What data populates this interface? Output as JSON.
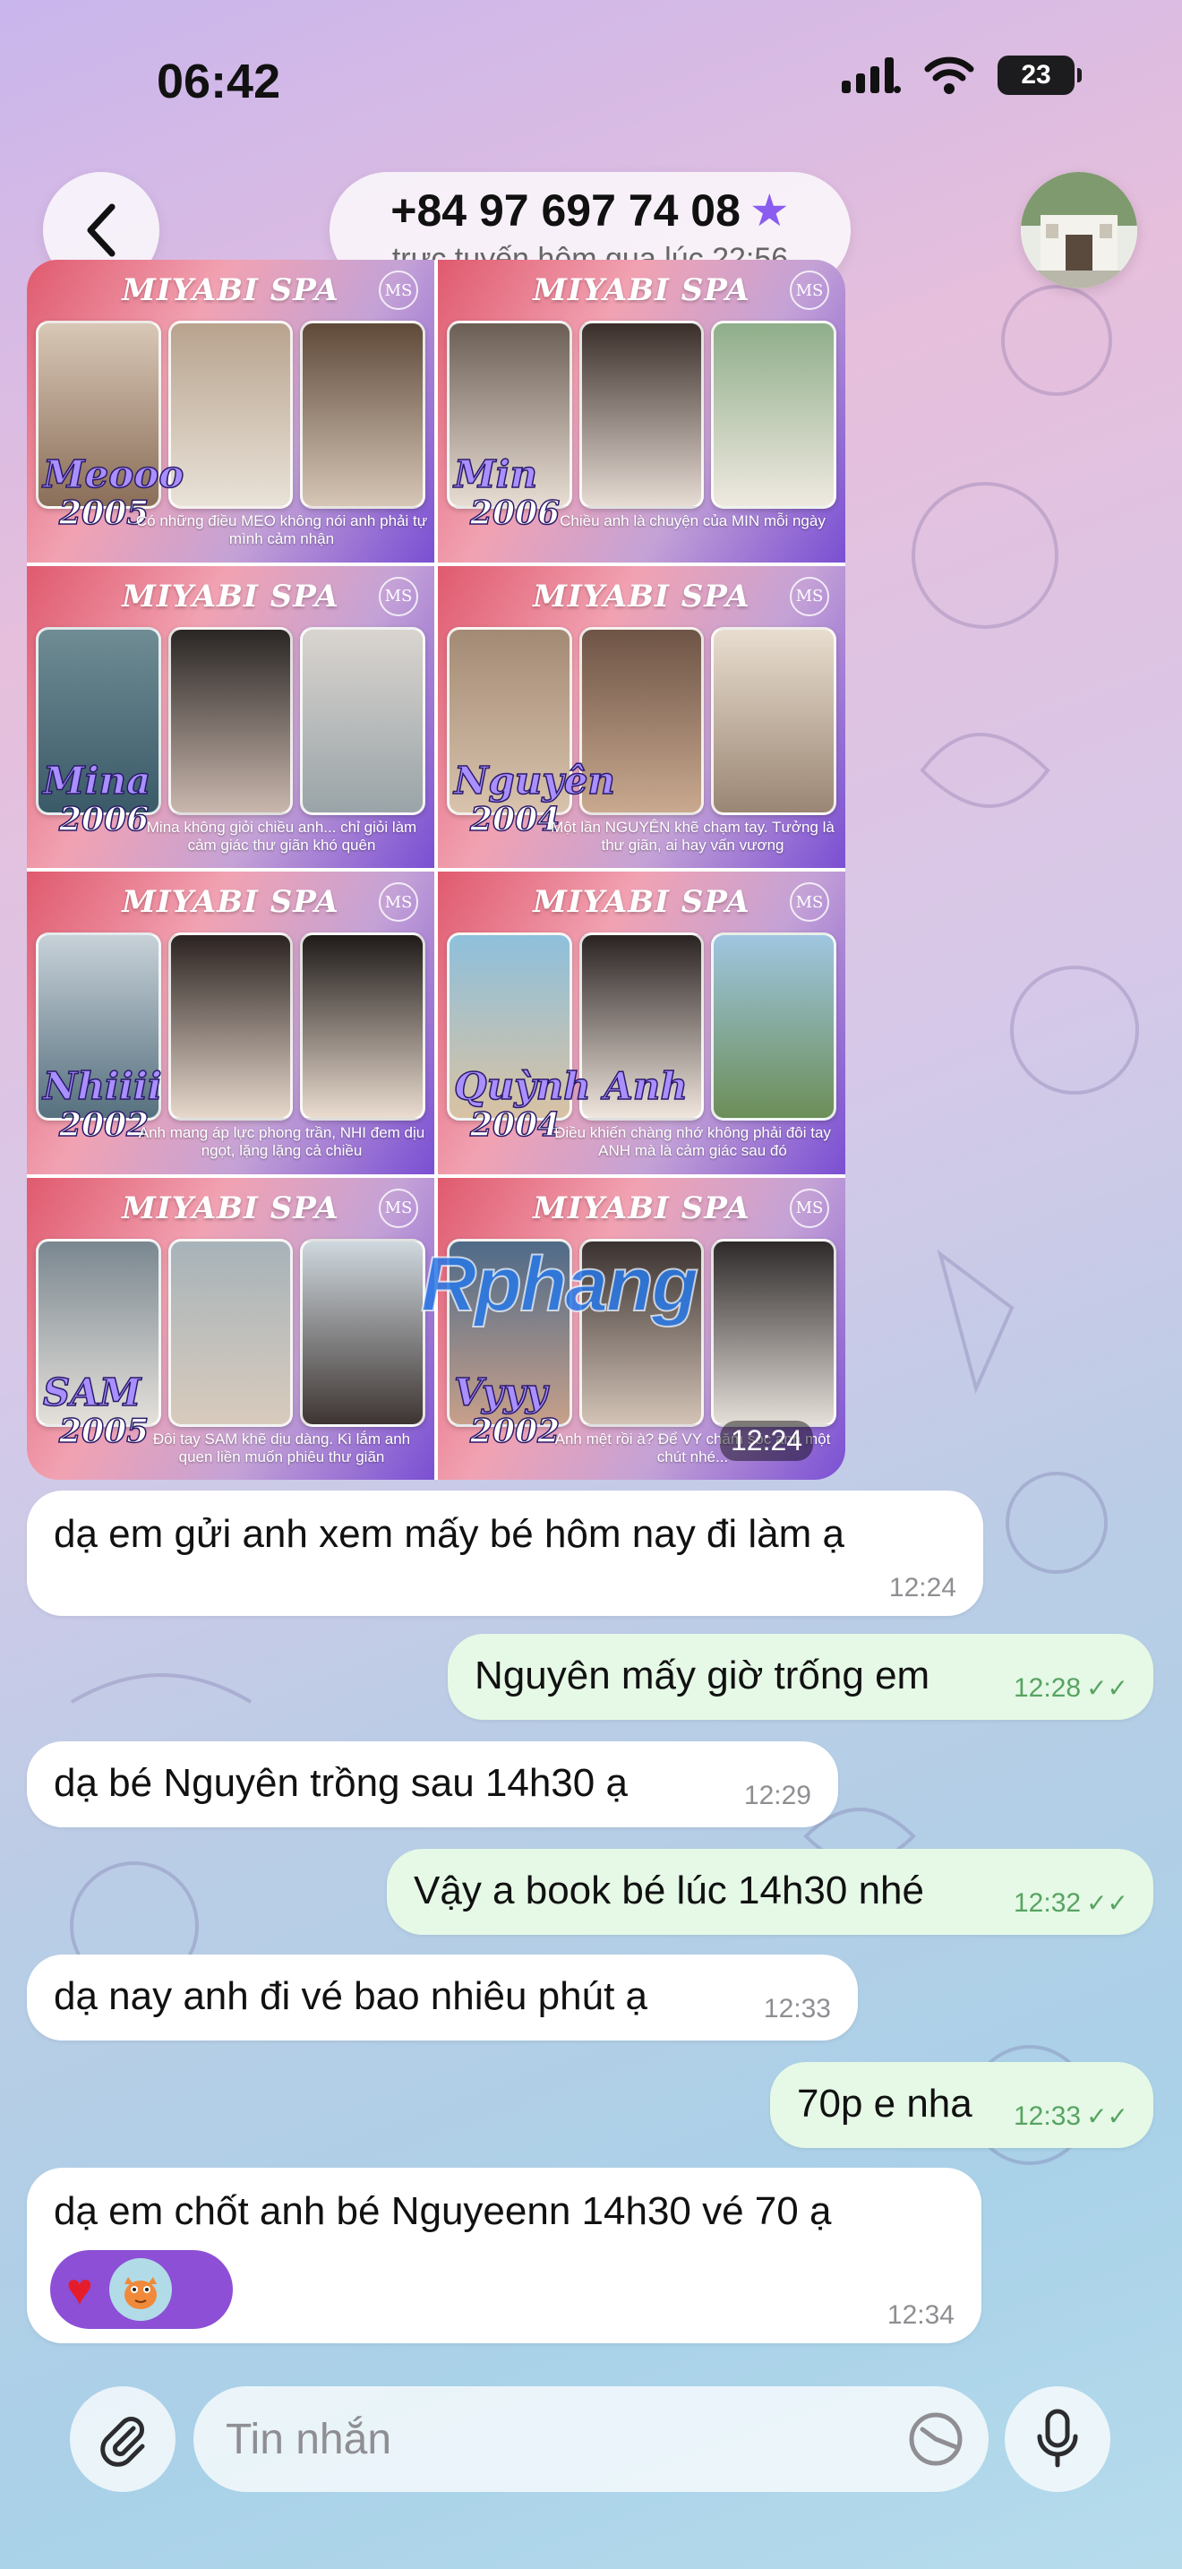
{
  "status_bar": {
    "time": "06:42",
    "battery": "23"
  },
  "header": {
    "contact_name": "+84 97 697 74 08",
    "contact_status": "trực tuyến hôm qua lúc 22:56"
  },
  "gallery": {
    "brand": "MIYABI SPA",
    "logo": "MS",
    "watermark": "Rphang",
    "time": "12:24",
    "tiles": [
      {
        "name": "Meooo",
        "year": "2005",
        "caption": "Có những điều MEO không nói anh phải tự mình cảm nhận"
      },
      {
        "name": "Min",
        "year": "2006",
        "caption": "Chiều anh là chuyện của MIN mỗi ngày"
      },
      {
        "name": "Mina",
        "year": "2006",
        "caption": "Mina không giỏi chiều anh... chỉ giỏi làm cảm giác thư giãn khó quên"
      },
      {
        "name": "Nguyên",
        "year": "2004",
        "caption": "Một lần NGUYÊN khẽ chạm tay. Tưởng là thư giãn, ai hay vấn vương"
      },
      {
        "name": "Nhiiii",
        "year": "2002",
        "caption": "Anh mang áp lực phong trần, NHI đem dịu ngọt, lặng lặng cả chiều"
      },
      {
        "name": "Quỳnh Anh",
        "year": "2004",
        "caption": "Điều khiến chàng nhớ không phải đôi tay ANH mà là cảm giác sau đó"
      },
      {
        "name": "SAM",
        "year": "2005",
        "caption": "Đôi tay SAM khẽ dịu dàng. Kì lắm anh quen liền muốn phiêu thư giãn"
      },
      {
        "name": "Vyyy",
        "year": "2002",
        "caption": "Anh mệt rồi à? Để VY chăm sóc anh một chút nhé..."
      }
    ]
  },
  "messages": [
    {
      "text": "dạ em gửi anh xem mấy bé hôm nay đi làm ạ",
      "time": "12:24",
      "direction": "in"
    },
    {
      "text": "Nguyên mấy giờ trống em",
      "time": "12:28",
      "direction": "out"
    },
    {
      "text": "dạ bé Nguyên trồng sau 14h30 ạ",
      "time": "12:29",
      "direction": "in"
    },
    {
      "text": "Vậy a book bé lúc 14h30 nhé",
      "time": "12:32",
      "direction": "out"
    },
    {
      "text": "dạ nay anh đi vé bao nhiêu phút ạ",
      "time": "12:33",
      "direction": "in"
    },
    {
      "text": "70p e nha",
      "time": "12:33",
      "direction": "out"
    },
    {
      "text": "dạ em chốt anh bé Nguyeenn 14h30 vé 70 ạ",
      "time": "12:34",
      "direction": "in"
    }
  ],
  "reactions": [
    "heart",
    "cartoon-avatar"
  ],
  "input": {
    "placeholder": "Tin nhắn"
  },
  "colors": {
    "outgoing_bubble": "#e5f9e6",
    "incoming_bubble": "#ffffff",
    "read_check": "#58a362",
    "star": "#8a5cf0",
    "reaction_pill": "#8c4fd6"
  }
}
